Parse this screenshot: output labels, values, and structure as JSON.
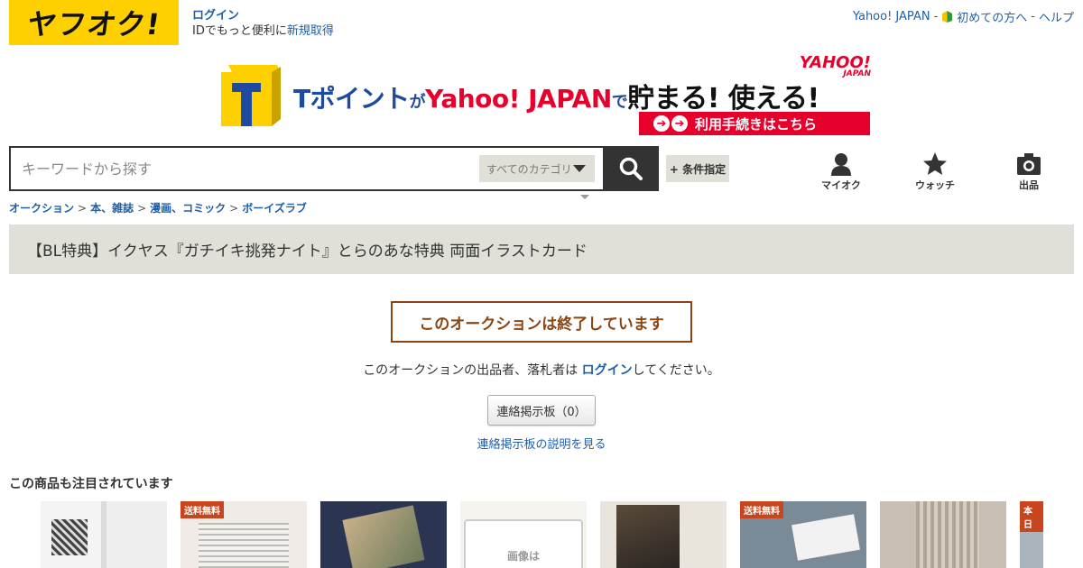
{
  "header": {
    "logo_text": "ヤフオク!",
    "login_label": "ログイン",
    "id_prompt": "IDでもっと便利に",
    "signup_label": "新規取得",
    "top_links": {
      "yahoo_japan": "Yahoo! JAPAN",
      "sep1": "-",
      "beginners": "初めての方へ",
      "sep2": "-",
      "help": "ヘルプ"
    }
  },
  "banner": {
    "t_point": "Tポイント",
    "ga": "が",
    "yahoo_japan": "Yahoo! JAPAN",
    "de": "で",
    "slogan": "貯まる! 使える!",
    "yahoo_logo": "YAHOO!",
    "yahoo_logo_sub": "JAPAN",
    "cta": "利用手続きはこちら"
  },
  "search": {
    "placeholder": "キーワードから探す",
    "category": "すべてのカテゴリ",
    "condition_label": "+ 条件指定"
  },
  "nav": {
    "myauction": "マイオク",
    "watch": "ウォッチ",
    "sell": "出品"
  },
  "breadcrumb": {
    "items": [
      "オークション",
      "本、雑誌",
      "漫画、コミック",
      "ボーイズラブ"
    ],
    "separator": ">"
  },
  "item": {
    "title": "【BL特典】イクヤス『ガチイキ挑発ナイト』とらのあな特典 両面イラストカード"
  },
  "status": {
    "ended": "このオークションは終了しています",
    "message_pre": "このオークションの出品者、落札者は ",
    "message_link": "ログイン",
    "message_post": "してください。",
    "board_button": "連絡掲示板（0）",
    "board_help": "連絡掲示板の説明を見る"
  },
  "related": {
    "heading": "この商品も注目されています",
    "badges": {
      "free_shipping": "送料無料",
      "domestic": "本日"
    },
    "no_image": "画像は"
  },
  "colors": {
    "brand_yellow": "#ffd000",
    "link_blue": "#1f5faa",
    "ended_brown": "#8b4513",
    "title_bg": "#e0e0d8"
  }
}
